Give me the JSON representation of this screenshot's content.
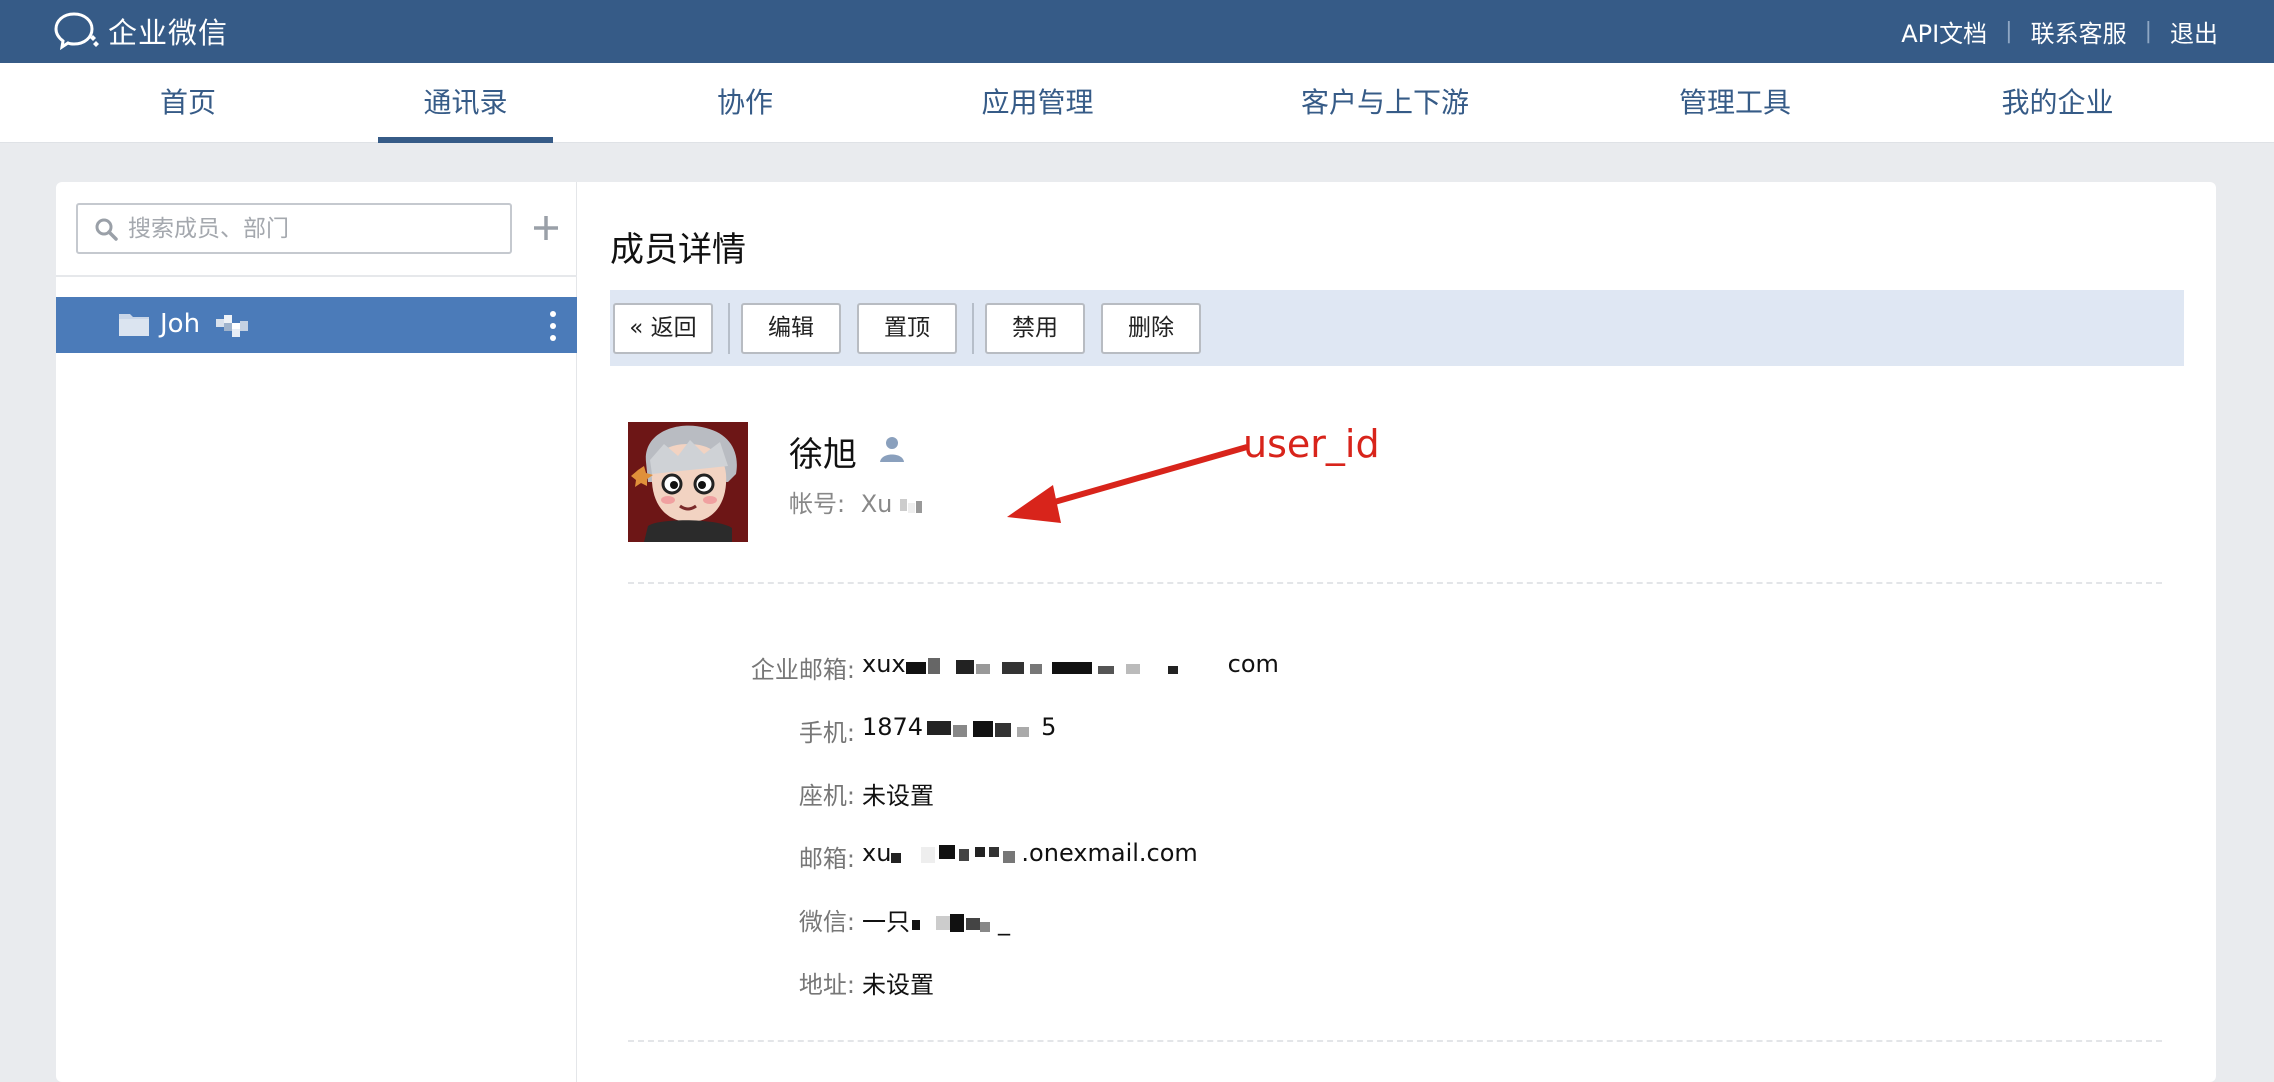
{
  "topbar": {
    "brand": "企业微信",
    "links": [
      "API文档",
      "联系客服",
      "退出"
    ]
  },
  "nav": {
    "items": [
      "首页",
      "通讯录",
      "协作",
      "应用管理",
      "客户与上下游",
      "管理工具",
      "我的企业"
    ],
    "active": "通讯录"
  },
  "sidebar": {
    "search_placeholder": "搜索成员、部门",
    "department": "Joh"
  },
  "detail": {
    "title": "成员详情",
    "toolbar": {
      "back": "« 返回",
      "edit": "编辑",
      "pin": "置顶",
      "disable": "禁用",
      "delete": "删除"
    },
    "member": {
      "name": "徐旭",
      "account_label": "帐号:",
      "account_value": "Xu"
    },
    "annotation": "user_id",
    "fields": [
      {
        "label": "企业邮箱:",
        "value_prefix": "xux",
        "value_suffix": "com"
      },
      {
        "label": "手机:",
        "value_prefix": "1874",
        "value_suffix": "5"
      },
      {
        "label": "座机:",
        "value_prefix": "未设置",
        "value_suffix": ""
      },
      {
        "label": "邮箱:",
        "value_prefix": "xu",
        "value_suffix": ".onexmail.com"
      },
      {
        "label": "微信:",
        "value_prefix": "一只",
        "value_suffix": "_"
      },
      {
        "label": "地址:",
        "value_prefix": "未设置",
        "value_suffix": ""
      }
    ]
  },
  "colors": {
    "topbar": "#365b87",
    "selected_row": "#4b7bb9",
    "toolbar_bg": "#dfe7f3",
    "annotation": "#d8241b"
  }
}
